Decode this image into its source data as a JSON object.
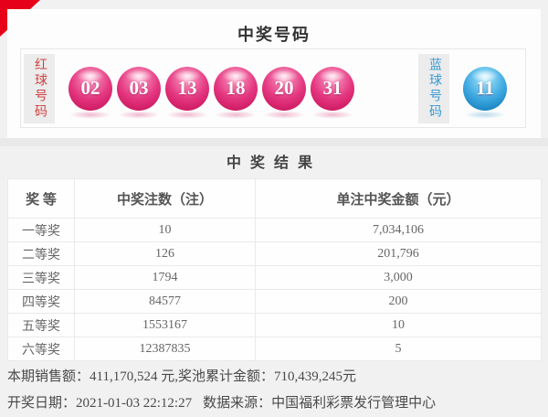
{
  "numbers_panel": {
    "title": "中奖号码",
    "red_label": "红球号码",
    "red_balls": [
      "02",
      "03",
      "13",
      "18",
      "20",
      "31"
    ],
    "blue_label": "蓝球号码",
    "blue_ball": "11"
  },
  "results_panel": {
    "title": "中奖结果",
    "headers": [
      "奖 等",
      "中奖注数（注）",
      "单注中奖金额（元）"
    ],
    "rows": [
      [
        "一等奖",
        "10",
        "7,034,106"
      ],
      [
        "二等奖",
        "126",
        "201,796"
      ],
      [
        "三等奖",
        "1794",
        "3,000"
      ],
      [
        "四等奖",
        "84577",
        "200"
      ],
      [
        "五等奖",
        "1553167",
        "10"
      ],
      [
        "六等奖",
        "12387835",
        "5"
      ]
    ]
  },
  "footer": {
    "sales_label": "本期销售额：",
    "sales_value": "411,170,524 元,",
    "pool_label": "奖池累计金额：",
    "pool_value": "710,439,245元",
    "draw_label": "开奖日期：",
    "draw_value": "2021-01-03 22:12:27",
    "source_label": "数据来源：",
    "source_value": "中国福利彩票发行管理中心"
  },
  "colors": {
    "accent_red": "#e60019",
    "red_ball": "#e43680",
    "blue_ball": "#1b86c4",
    "red_label_text": "#cf4343",
    "blue_label_text": "#3a9ad2",
    "page_bg": "#f1f1f1"
  }
}
